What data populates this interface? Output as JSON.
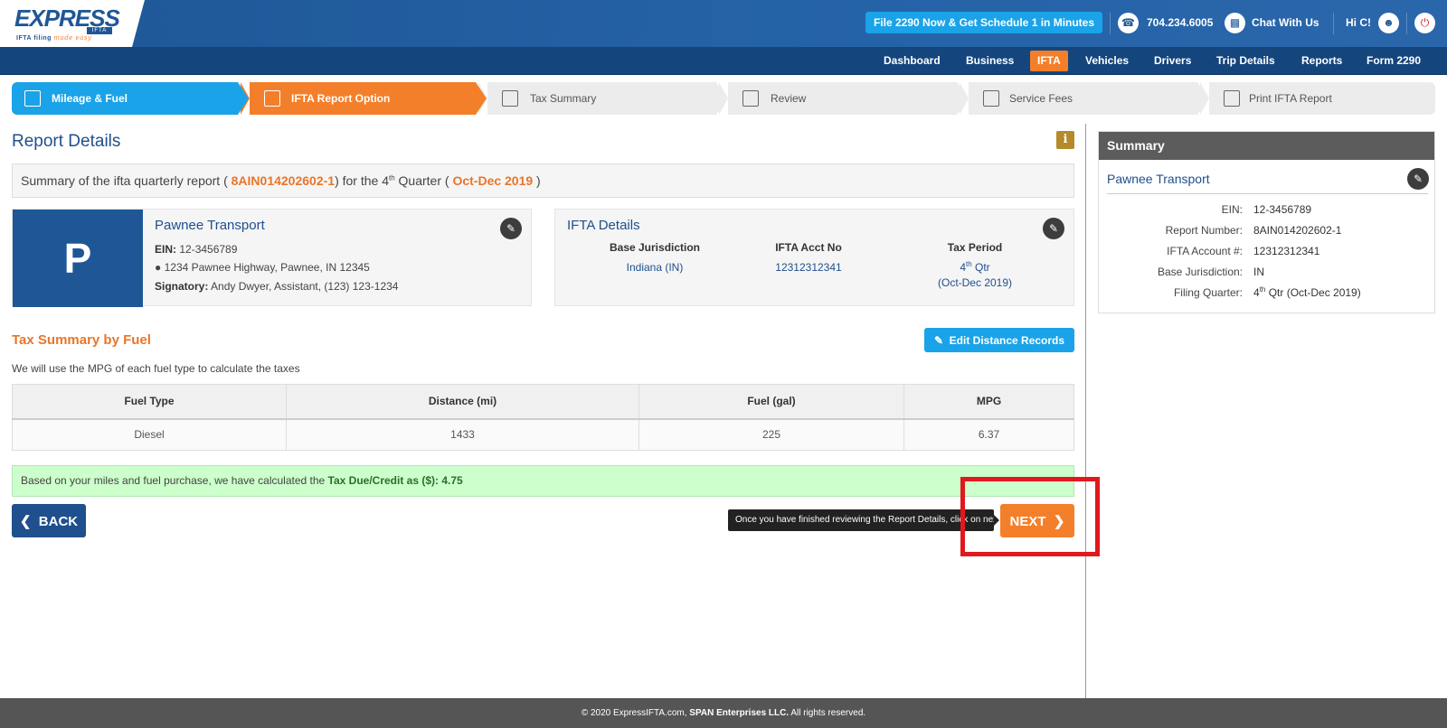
{
  "brand": {
    "name": "EXPRESS",
    "sub": "IFTA",
    "tag_main": "IFTA filing",
    "tag_accent": "made easy"
  },
  "header": {
    "promo": "File 2290 Now & Get Schedule 1 in Minutes",
    "phone": "704.234.6005",
    "chat": "Chat With Us",
    "greeting": "Hi C!"
  },
  "nav": {
    "items": [
      {
        "label": "Dashboard",
        "active": false
      },
      {
        "label": "Business",
        "active": false
      },
      {
        "label": "IFTA",
        "active": true
      },
      {
        "label": "Vehicles",
        "active": false
      },
      {
        "label": "Drivers",
        "active": false
      },
      {
        "label": "Trip Details",
        "active": false
      },
      {
        "label": "Reports",
        "active": false
      },
      {
        "label": "Form 2290",
        "active": false
      }
    ]
  },
  "steps": [
    {
      "label": "Mileage & Fuel",
      "icon": "fuel-pump-icon",
      "state": "done"
    },
    {
      "label": "IFTA Report Option",
      "icon": "report-icon",
      "state": "active"
    },
    {
      "label": "Tax Summary",
      "icon": "summary-icon",
      "state": "pending"
    },
    {
      "label": "Review",
      "icon": "review-icon",
      "state": "pending"
    },
    {
      "label": "Service Fees",
      "icon": "cash-icon",
      "state": "pending"
    },
    {
      "label": "Print IFTA Report",
      "icon": "printer-icon",
      "state": "pending"
    }
  ],
  "report": {
    "title": "Report Details",
    "summary_prefix": "Summary of the ifta quarterly report ( ",
    "report_number": "8AIN014202602-1",
    "summary_mid_a": ") for the 4",
    "summary_mid_sup": "th",
    "summary_mid_b": " Quarter ( ",
    "period": "Oct-Dec 2019",
    "summary_suffix": " )"
  },
  "business": {
    "initial": "P",
    "name": "Pawnee Transport",
    "ein_label": "EIN:",
    "ein": "12-3456789",
    "address": "1234 Pawnee Highway, Pawnee, IN 12345",
    "signatory_label": "Signatory:",
    "signatory": "Andy Dwyer, Assistant, (123) 123-1234"
  },
  "ifta": {
    "title": "IFTA Details",
    "base_label": "Base Jurisdiction",
    "base_value": "Indiana (IN)",
    "acct_label": "IFTA Acct No",
    "acct_value": "12312312341",
    "period_label": "Tax Period",
    "period_num": "4",
    "period_sup": "th",
    "period_qtr": " Qtr",
    "period_range": "(Oct-Dec 2019)"
  },
  "fuel_section": {
    "title": "Tax Summary by Fuel",
    "edit_label": "Edit Distance Records",
    "note": "We will use the MPG of each fuel type to calculate the taxes",
    "columns": [
      "Fuel Type",
      "Distance (mi)",
      "Fuel (gal)",
      "MPG"
    ],
    "rows": [
      [
        "Diesel",
        "1433",
        "225",
        "6.37"
      ]
    ]
  },
  "tax": {
    "prefix": "Based on your miles and fuel purchase, we have calculated the ",
    "label": "Tax Due/Credit as ($): 4.75"
  },
  "actions": {
    "back": "BACK",
    "next": "NEXT",
    "tooltip": "Once you have finished reviewing the Report Details, click on next"
  },
  "sidebar": {
    "title": "Summary",
    "business": "Pawnee Transport",
    "rows": [
      {
        "k": "EIN:",
        "v": "12-3456789"
      },
      {
        "k": "Report Number:",
        "v": "8AIN014202602-1"
      },
      {
        "k": "IFTA Account #:",
        "v": "12312312341"
      },
      {
        "k": "Base Jurisdiction:",
        "v": "IN"
      }
    ],
    "quarter_label": "Filing Quarter:",
    "quarter_num": "4",
    "quarter_sup": "th",
    "quarter_rest": " Qtr (Oct-Dec 2019)"
  },
  "footer": {
    "prefix": "© 2020 ExpressIFTA.com, ",
    "company": "SPAN Enterprises LLC.",
    "suffix": " All rights reserved."
  },
  "colors": {
    "brand_blue": "#1f5796",
    "accent_orange": "#f47f2a",
    "sky": "#1aa3e8",
    "highlight": "#e0191e"
  }
}
